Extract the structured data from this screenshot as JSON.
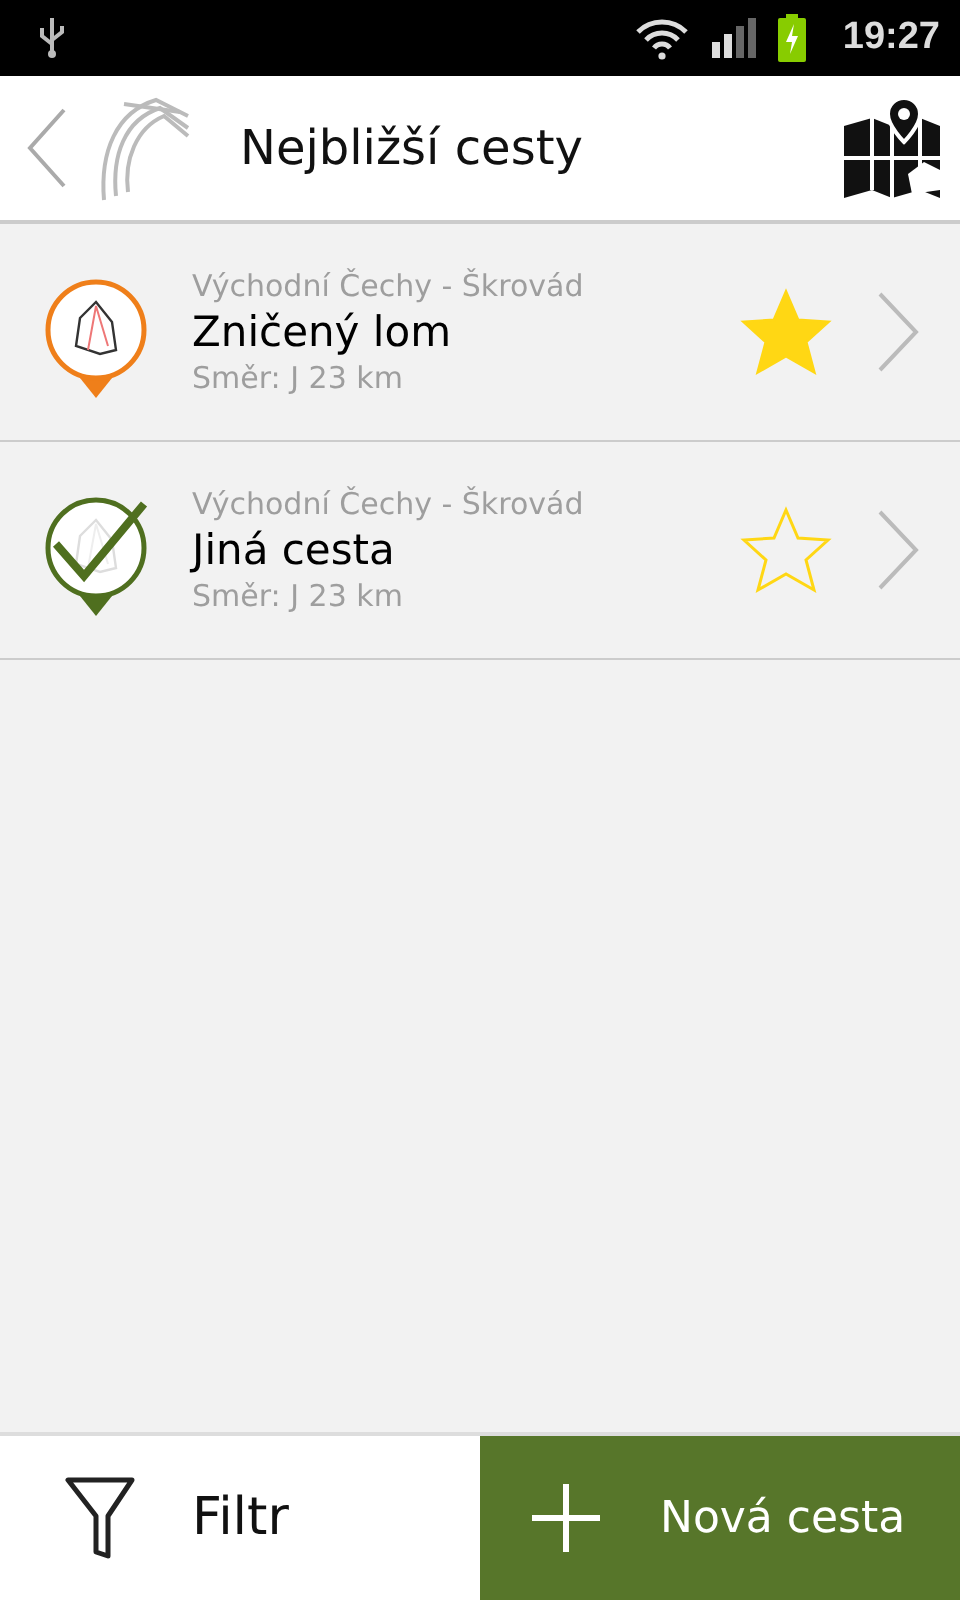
{
  "status_bar": {
    "time": "19:27"
  },
  "header": {
    "title": "Nejbližší cesty"
  },
  "routes": [
    {
      "region": "Východní Čechy - Škrovád",
      "name": "Zničený lom",
      "details": "Směr: J  23 km",
      "color": "#ef7f1a",
      "climbed": false,
      "favorite": true
    },
    {
      "region": "Východní Čechy - Škrovád",
      "name": "Jiná cesta",
      "details": "Směr: J  23 km",
      "color": "#4f6f1f",
      "climbed": true,
      "favorite": false
    }
  ],
  "bottom_bar": {
    "filter_label": "Filtr",
    "new_label": "Nová cesta"
  }
}
